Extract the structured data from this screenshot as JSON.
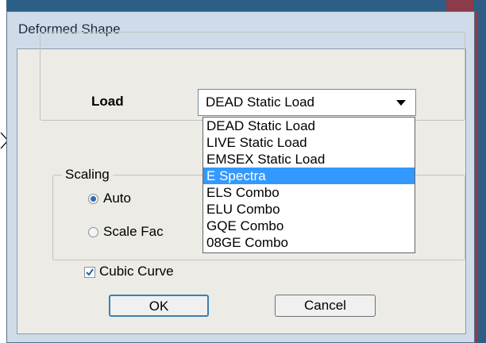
{
  "dialog": {
    "title": "Deformed Shape"
  },
  "load": {
    "label": "Load",
    "selected": "DEAD Static Load",
    "options": [
      "DEAD Static Load",
      "LIVE Static Load",
      "EMSEX Static Load",
      "E Spectra",
      "ELS Combo",
      "ELU Combo",
      "GQE Combo",
      "08GE Combo"
    ],
    "highlighted_index": 3
  },
  "scaling": {
    "label": "Scaling",
    "auto_label": "Auto",
    "auto_selected": true,
    "scale_factor_label": "Scale Fac"
  },
  "cubic_curve": {
    "label": "Cubic Curve",
    "checked": true
  },
  "buttons": {
    "ok": "OK",
    "cancel": "Cancel"
  },
  "colors": {
    "titlebar_bg": "#cfdbe8",
    "selection": "#3399ff",
    "desktop": "#2d5f86"
  }
}
